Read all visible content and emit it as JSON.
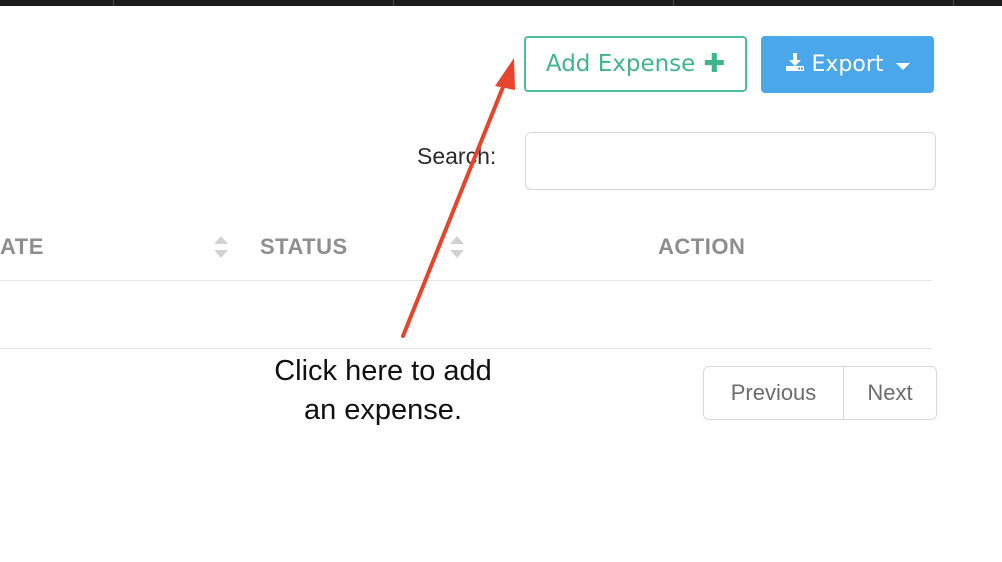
{
  "toolbar": {
    "add_expense_label": "Add Expense",
    "add_icon": "plus-icon",
    "export_label": "Export",
    "export_icon": "download-icon",
    "export_caret_icon": "caret-down-icon"
  },
  "search": {
    "label": "Search:",
    "value": "",
    "placeholder": ""
  },
  "table": {
    "columns": [
      {
        "label": "ATE",
        "sortable": true
      },
      {
        "label": "STATUS",
        "sortable": true
      },
      {
        "label": "ACTION",
        "sortable": false
      }
    ],
    "rows": []
  },
  "pagination": {
    "previous_label": "Previous",
    "next_label": "Next"
  },
  "annotation": {
    "line1": "Click here to add",
    "line2": "an expense.",
    "arrow_color": "#e8432c"
  },
  "colors": {
    "add_button": "#3fb58d",
    "export_button": "#4aa7ea",
    "header_text": "#8e8e8e"
  }
}
